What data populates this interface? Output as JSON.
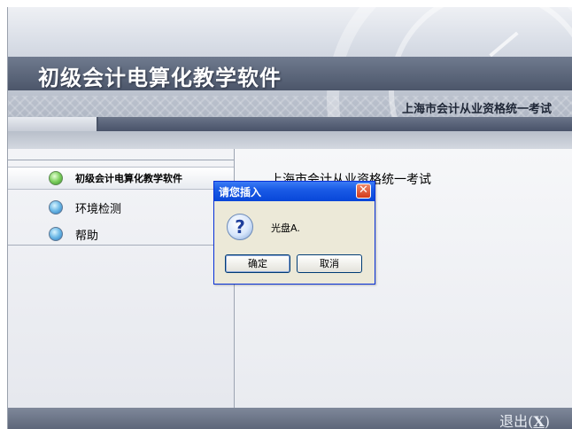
{
  "header": {
    "title": "初级会计电算化教学软件",
    "subtitle": "上海市会计从业资格统一考试"
  },
  "sidebar": {
    "items": [
      {
        "label": "初级会计电算化教学软件",
        "icon": "green-orb-icon"
      },
      {
        "label": "环境检测",
        "icon": "blue-orb-icon"
      },
      {
        "label": "帮助",
        "icon": "blue-orb-icon"
      }
    ]
  },
  "main": {
    "heading": "上海市会计从业资格统一考试"
  },
  "footer": {
    "exit_label": "退出(",
    "exit_key": "X",
    "exit_close": ")"
  },
  "dialog": {
    "title": "请您插入",
    "close_glyph": "✕",
    "icon_glyph": "?",
    "message": "光盘A.",
    "ok_label": "确定",
    "cancel_label": "取消"
  },
  "colors": {
    "title_bar": "#0846d8",
    "dialog_bg": "#ece9d8",
    "footer": "#5d6679"
  }
}
